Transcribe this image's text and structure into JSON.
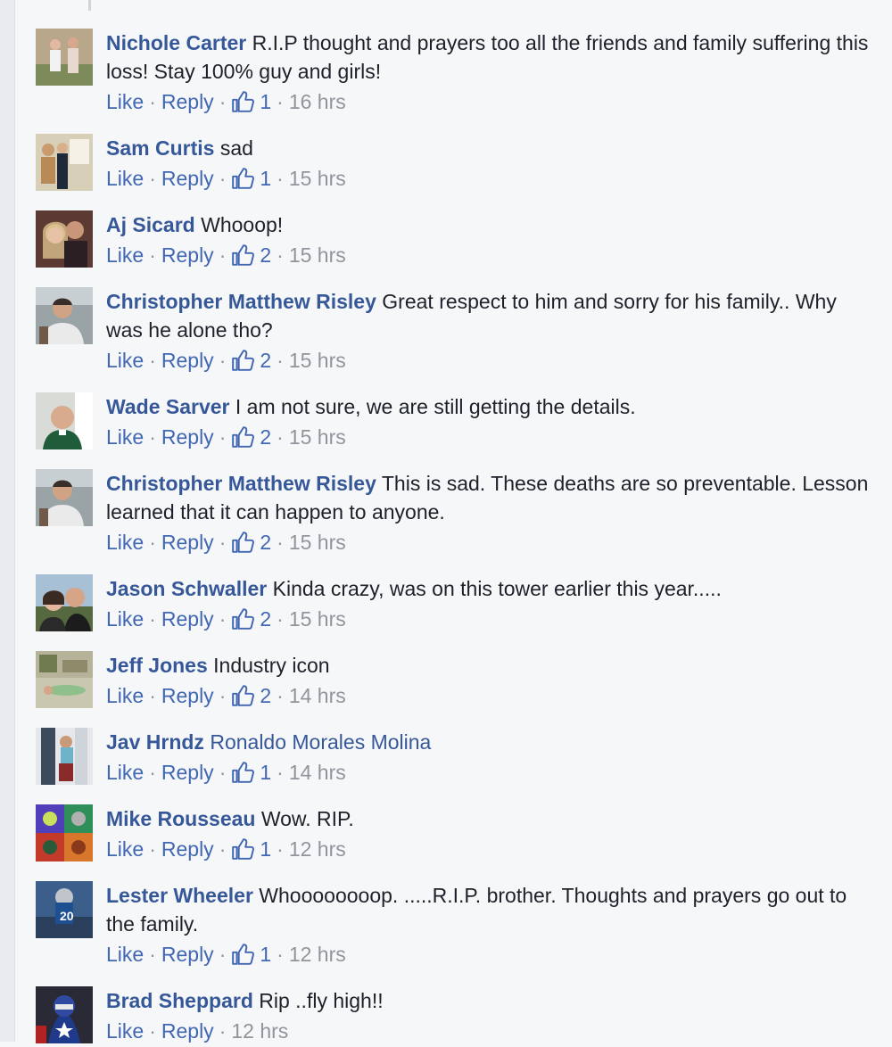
{
  "labels": {
    "like": "Like",
    "reply": "Reply",
    "separator": "·"
  },
  "colors": {
    "author": "#365899",
    "link": "#4267b2",
    "meta": "#90949c",
    "background": "#f6f7f9"
  },
  "comments": [
    {
      "author": "Nichole Carter",
      "text": "R.I.P thought and prayers too all the friends and family suffering this loss! Stay 100% guy and girls!",
      "likes": "1",
      "time": "16 hrs"
    },
    {
      "author": "Sam Curtis",
      "text": "sad",
      "likes": "1",
      "time": "15 hrs"
    },
    {
      "author": "Aj Sicard",
      "text": "Whooop!",
      "likes": "2",
      "time": "15 hrs"
    },
    {
      "author": "Christopher Matthew Risley",
      "text": "Great respect to him and sorry for his family.. Why was he alone tho?",
      "likes": "2",
      "time": "15 hrs"
    },
    {
      "author": "Wade Sarver",
      "text": "I am not sure, we are still getting the details.",
      "likes": "2",
      "time": "15 hrs"
    },
    {
      "author": "Christopher Matthew Risley",
      "text": "This is sad. These deaths are so preventable. Lesson learned that it can happen to anyone.",
      "likes": "2",
      "time": "15 hrs"
    },
    {
      "author": "Jason Schwaller",
      "text": "Kinda crazy, was on this tower earlier this year.....",
      "likes": "2",
      "time": "15 hrs"
    },
    {
      "author": "Jeff Jones",
      "text": "Industry icon",
      "likes": "2",
      "time": "14 hrs"
    },
    {
      "author": "Jav Hrndz",
      "mention": "Ronaldo Morales Molina",
      "likes": "1",
      "time": "14 hrs"
    },
    {
      "author": "Mike Rousseau",
      "text": "Wow. RIP.",
      "likes": "1",
      "time": "12 hrs"
    },
    {
      "author": "Lester Wheeler",
      "text": "Whoooooooop. .....R.I.P. brother. Thoughts and prayers go out to the family.",
      "likes": "1",
      "time": "12 hrs"
    },
    {
      "author": "Brad Sheppard",
      "text": "Rip ..fly high!!",
      "time": "12 hrs"
    }
  ]
}
